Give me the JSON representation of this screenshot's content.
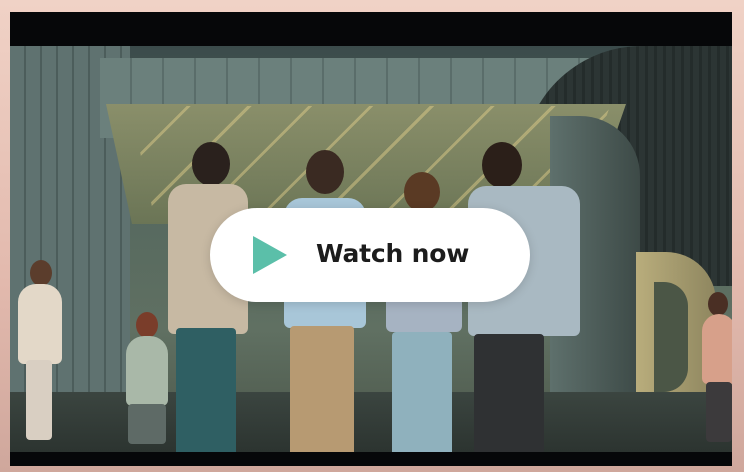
{
  "cta": {
    "label": "Watch now",
    "icon": "play-icon"
  },
  "colors": {
    "accent": "#5bbfa9",
    "cta_background": "#ffffff",
    "frame": "#060709"
  }
}
